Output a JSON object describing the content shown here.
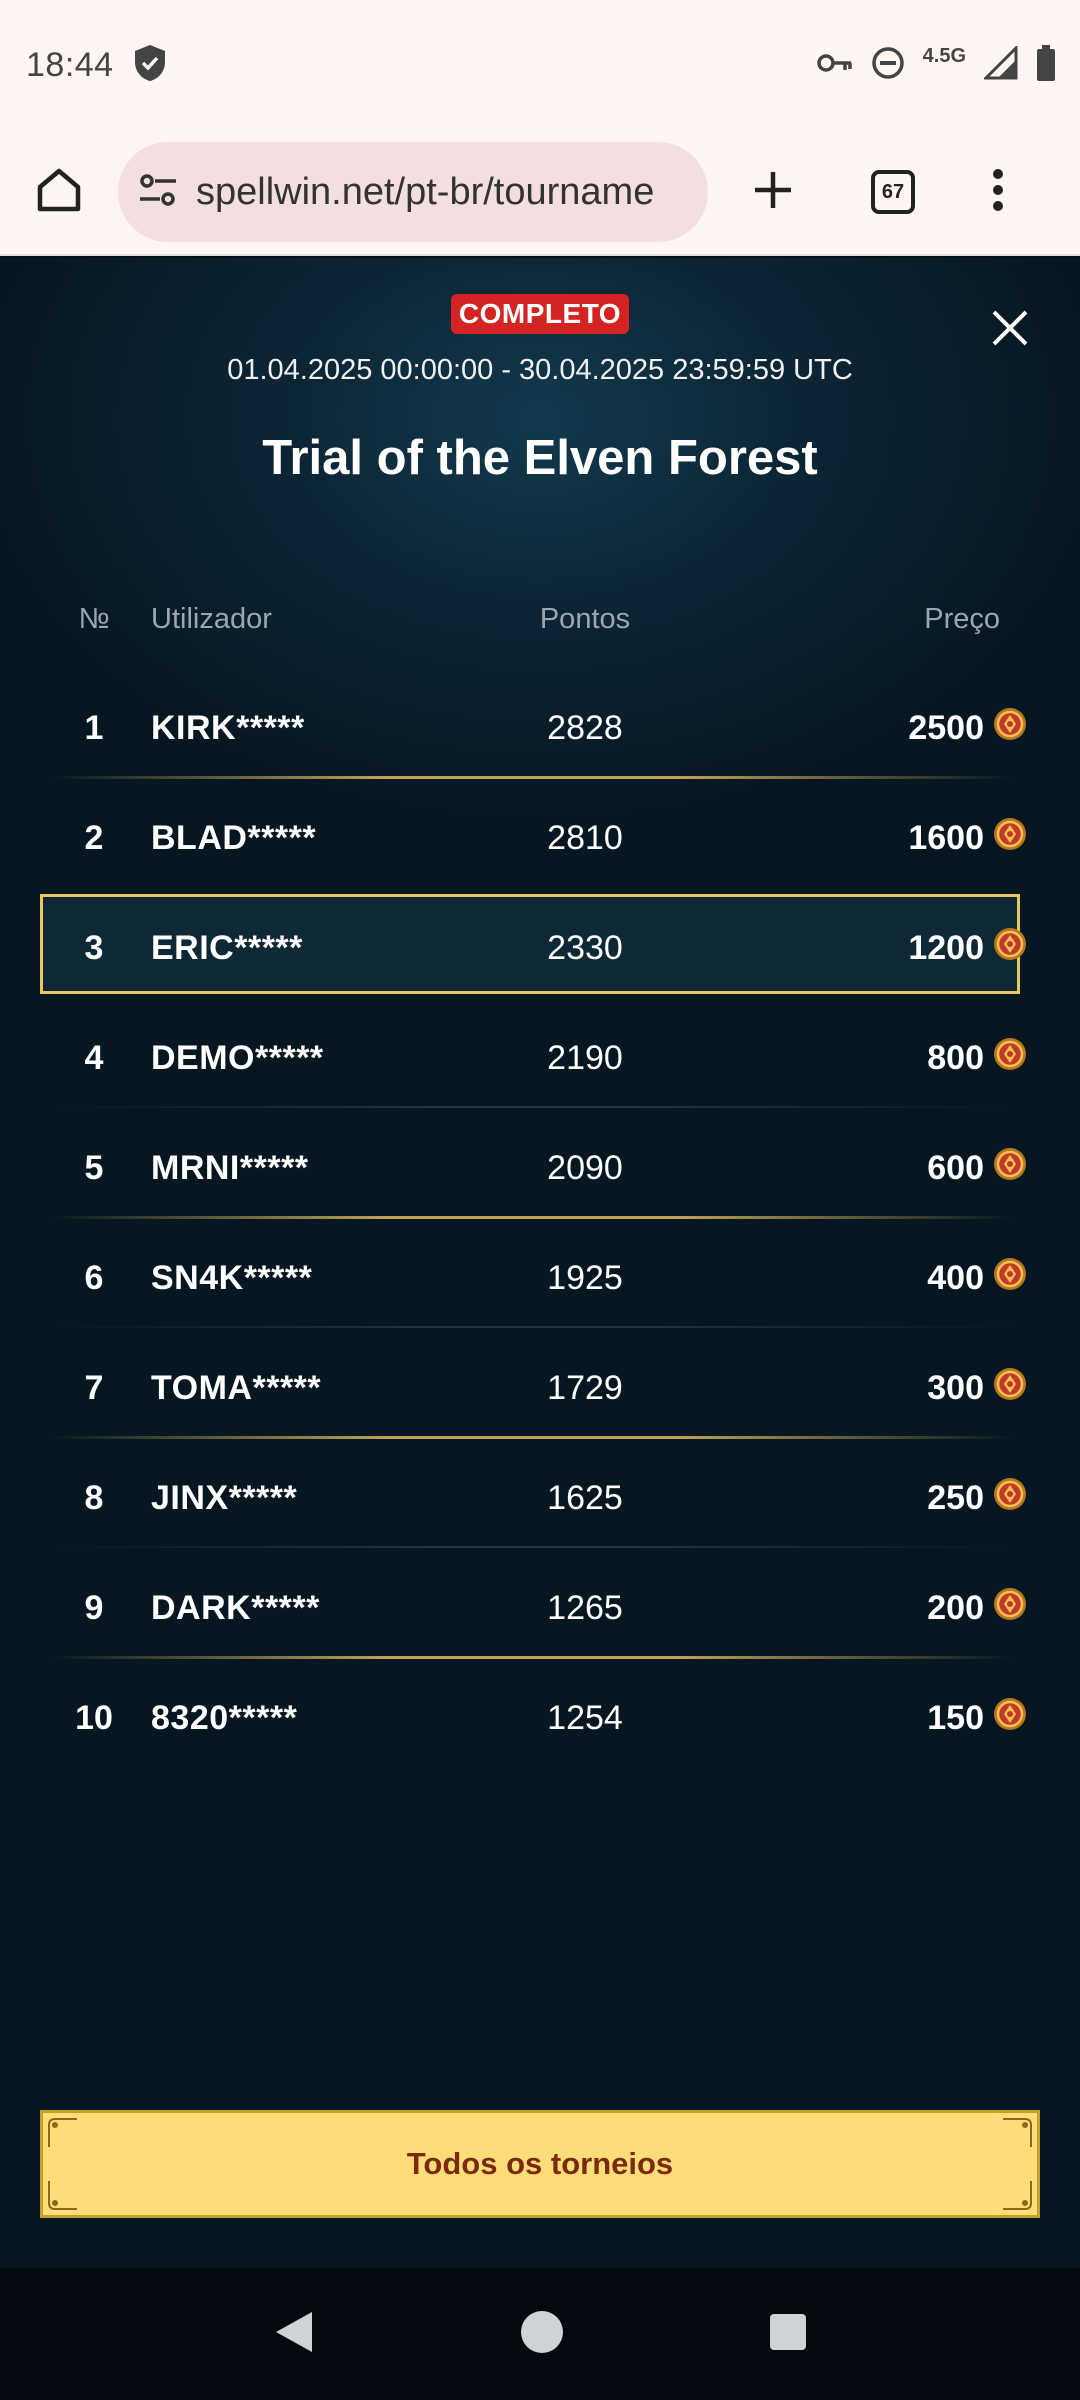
{
  "status_bar": {
    "time": "18:44",
    "network_label": "4.5G",
    "icons": [
      "shield-icon",
      "key-icon",
      "do-not-disturb-icon",
      "signal-icon",
      "battery-icon"
    ]
  },
  "browser": {
    "url": "spellwin.net/pt-br/tourname",
    "tab_count": "67",
    "icons": [
      "home-icon",
      "site-settings-icon",
      "plus-icon",
      "more-vert-icon"
    ]
  },
  "tournament": {
    "status_badge": "COMPLETO",
    "date_range": "01.04.2025 00:00:00 - 30.04.2025 23:59:59 UTC",
    "title": "Trial of the Elven Forest",
    "columns": {
      "rank": "№",
      "user": "Utilizador",
      "points": "Pontos",
      "prize": "Preço"
    },
    "rows": [
      {
        "rank": "1",
        "user": "KIRK*****",
        "points": "2828",
        "prize": "2500"
      },
      {
        "rank": "2",
        "user": "BLAD*****",
        "points": "2810",
        "prize": "1600"
      },
      {
        "rank": "3",
        "user": "ERIC*****",
        "points": "2330",
        "prize": "1200"
      },
      {
        "rank": "4",
        "user": "DEMO*****",
        "points": "2190",
        "prize": "800"
      },
      {
        "rank": "5",
        "user": "MRNI*****",
        "points": "2090",
        "prize": "600"
      },
      {
        "rank": "6",
        "user": "SN4K*****",
        "points": "1925",
        "prize": "400"
      },
      {
        "rank": "7",
        "user": "TOMA*****",
        "points": "1729",
        "prize": "300"
      },
      {
        "rank": "8",
        "user": "JINX*****",
        "points": "1625",
        "prize": "250"
      },
      {
        "rank": "9",
        "user": "DARK*****",
        "points": "1265",
        "prize": "200"
      },
      {
        "rank": "10",
        "user": "8320*****",
        "points": "1254",
        "prize": "150"
      }
    ],
    "highlighted_rank": "3",
    "all_tournaments_button": "Todos os torneios"
  },
  "colors": {
    "badge": "#d42323",
    "highlight_border": "#e9c762",
    "button_bg": "#fedd78",
    "button_text": "#7a2a10",
    "panel_bg": "#0c2535"
  },
  "nav": {
    "icons": [
      "back-icon",
      "home-nav-icon",
      "recents-icon"
    ]
  }
}
